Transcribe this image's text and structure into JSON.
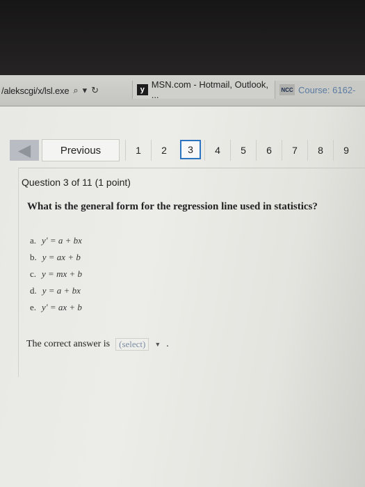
{
  "browser": {
    "address_url": "/alekscgi/x/lsl.exe",
    "tabs": [
      {
        "icon": "y",
        "label": "MSN.com - Hotmail, Outlook, ..."
      },
      {
        "icon": "NCC",
        "label": "Course: 6162-"
      }
    ]
  },
  "nav": {
    "previous_label": "Previous",
    "pages": [
      "1",
      "2",
      "3",
      "4",
      "5",
      "6",
      "7",
      "8",
      "9"
    ],
    "current_page": "3"
  },
  "question": {
    "header": "Question 3 of 11 (1 point)",
    "text": "What is the general form for the regression line used in statistics?",
    "options": [
      {
        "letter": "a.",
        "formula": "y' = a + bx"
      },
      {
        "letter": "b.",
        "formula": "y = ax + b"
      },
      {
        "letter": "c.",
        "formula": "y = mx + b"
      },
      {
        "letter": "d.",
        "formula": "y = a + bx"
      },
      {
        "letter": "e.",
        "formula": "y' = ax + b"
      }
    ],
    "answer_prefix": "The correct answer is",
    "answer_select": "(select)",
    "answer_suffix": "."
  }
}
